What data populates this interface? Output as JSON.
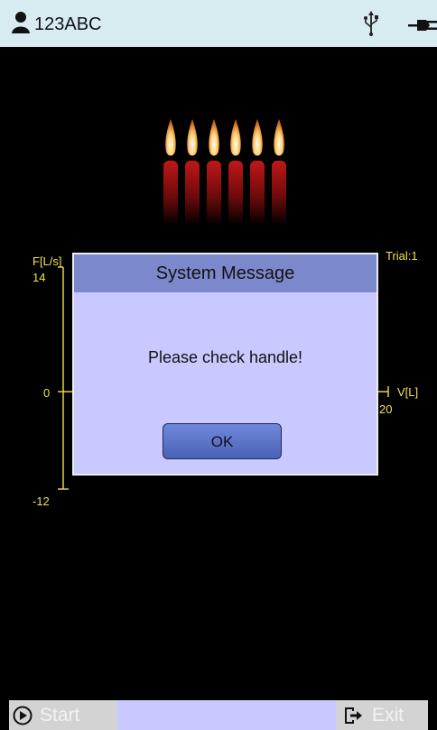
{
  "header": {
    "patient_id": "123ABC",
    "icons": [
      "user-icon",
      "usb-icon",
      "power-plug-icon"
    ]
  },
  "graph": {
    "y_label": "F[L/s]",
    "x_label": "V[L]",
    "trial_label": "Trial:1",
    "y_ticks": [
      "14",
      "0",
      "-12"
    ],
    "x_max_label": "20",
    "colors": {
      "axis": "#f0e34a"
    }
  },
  "dialog": {
    "title": "System Message",
    "message": "Please check handle!",
    "ok_label": "OK"
  },
  "footer": {
    "start_label": "Start",
    "exit_label": "Exit"
  }
}
